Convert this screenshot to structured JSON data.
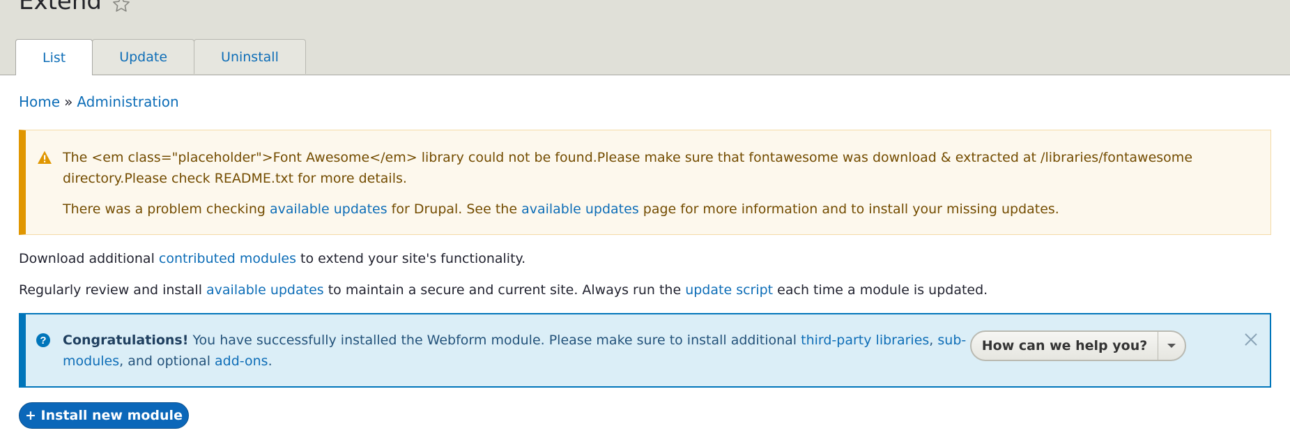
{
  "header": {
    "title": "Extend",
    "star_icon": "star-outline-icon",
    "tabs": [
      {
        "label": "List",
        "active": true
      },
      {
        "label": "Update",
        "active": false
      },
      {
        "label": "Uninstall",
        "active": false
      }
    ]
  },
  "breadcrumb": {
    "home": "Home",
    "separator": "»",
    "administration": "Administration"
  },
  "warning": {
    "icon": "warning-icon",
    "line1": "The <em class=\"placeholder\">Font Awesome</em> library could not be found.Please make sure that fontawesome was download & extracted at /libraries/fontawesome directory.Please check README.txt for more details.",
    "line2_a": "There was a problem checking ",
    "line2_link1": "available updates",
    "line2_b": " for Drupal. See the ",
    "line2_link2": "available updates",
    "line2_c": " page for more information and to install your missing updates."
  },
  "paragraphs": {
    "p1_a": "Download additional ",
    "p1_link": "contributed modules",
    "p1_b": " to extend your site's functionality.",
    "p2_a": "Regularly review and install ",
    "p2_link1": "available updates",
    "p2_b": " to maintain a secure and current site. Always run the ",
    "p2_link2": "update script",
    "p2_c": " each time a module is updated."
  },
  "status": {
    "icon": "help-icon",
    "strong": "Congratulations!",
    "text_a": " You have successfully installed the Webform module. Please make sure to install additional ",
    "link1": "third-party libraries",
    "text_b": ", ",
    "link2": "sub-modules",
    "text_c": ", and optional ",
    "link3": "add-ons",
    "text_d": ".",
    "help_button_label": "How can we help you?",
    "close_icon": "close-icon"
  },
  "install_button": "+ Install new module",
  "colors": {
    "accent": "#0d6db7",
    "warning_border": "#e09600",
    "status_border": "#0075ba"
  }
}
